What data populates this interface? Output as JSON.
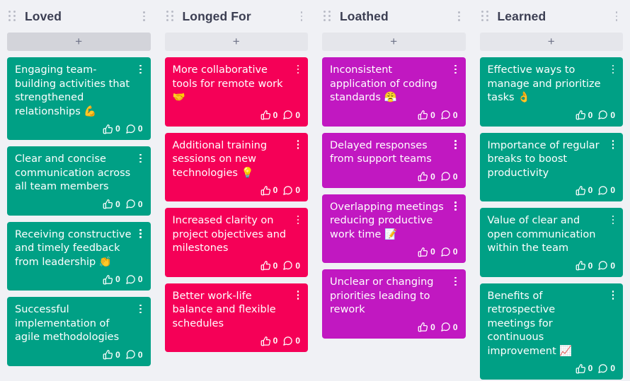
{
  "board": {
    "background_color": "#f0f1f5",
    "add_card_label": "+",
    "columns": [
      {
        "id": "loved",
        "title": "Loved",
        "card_color": "#00a085",
        "add_button_hovered": true,
        "cards": [
          {
            "text": "Engaging team-building activities that strengthened relationships 💪",
            "likes": "0",
            "comments": "0"
          },
          {
            "text": "Clear and concise communication across all team members",
            "likes": "0",
            "comments": "0"
          },
          {
            "text": "Receiving constructive and timely feedback from leadership 👏",
            "likes": "0",
            "comments": "0"
          },
          {
            "text": "Successful implementation of agile methodologies",
            "likes": "0",
            "comments": "0"
          }
        ]
      },
      {
        "id": "longed-for",
        "title": "Longed For",
        "card_color": "#f50057",
        "add_button_hovered": false,
        "cards": [
          {
            "text": "More collaborative tools for remote work 🤝",
            "likes": "0",
            "comments": "0"
          },
          {
            "text": "Additional training sessions on new technologies 💡",
            "likes": "0",
            "comments": "0"
          },
          {
            "text": "Increased clarity on project objectives and milestones",
            "likes": "0",
            "comments": "0"
          },
          {
            "text": "Better work-life balance and flexible schedules",
            "likes": "0",
            "comments": "0"
          }
        ]
      },
      {
        "id": "loathed",
        "title": "Loathed",
        "card_color": "#c118c1",
        "add_button_hovered": false,
        "cards": [
          {
            "text": "Inconsistent application of coding standards 😤",
            "likes": "0",
            "comments": "0"
          },
          {
            "text": "Delayed responses from support teams",
            "likes": "0",
            "comments": "0"
          },
          {
            "text": "Overlapping meetings reducing productive work time 📝",
            "likes": "0",
            "comments": "0"
          },
          {
            "text": "Unclear or changing priorities leading to rework",
            "likes": "0",
            "comments": "0"
          }
        ]
      },
      {
        "id": "learned",
        "title": "Learned",
        "card_color": "#00a085",
        "add_button_hovered": false,
        "cards": [
          {
            "text": "Effective ways to manage and prioritize tasks 👌",
            "likes": "0",
            "comments": "0"
          },
          {
            "text": "Importance of regular breaks to boost productivity",
            "likes": "0",
            "comments": "0"
          },
          {
            "text": "Value of clear and open communication within the team",
            "likes": "0",
            "comments": "0"
          },
          {
            "text": "Benefits of retrospective meetings for continuous improvement 📈",
            "likes": "0",
            "comments": "0"
          }
        ]
      }
    ]
  }
}
